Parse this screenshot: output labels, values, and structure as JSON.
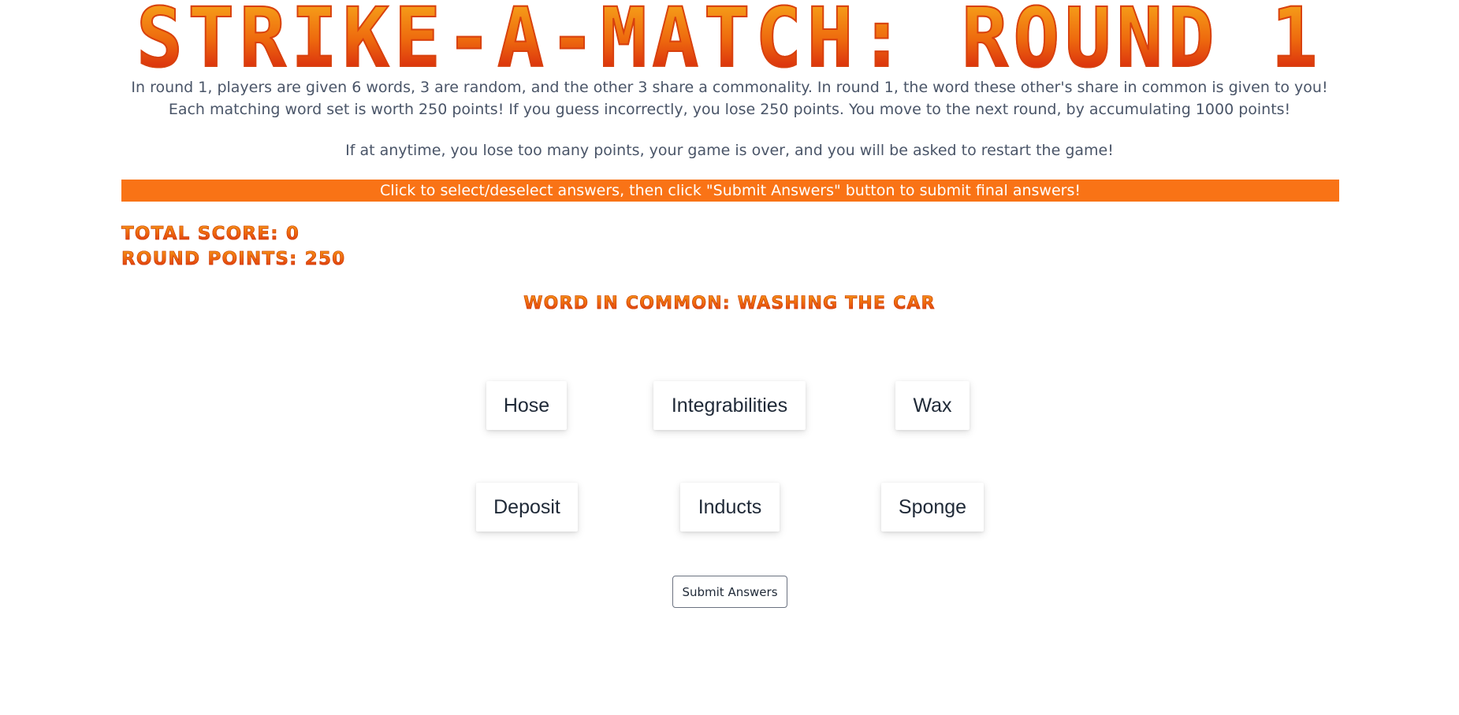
{
  "game": {
    "title": "Strike-a-Match: Round 1",
    "instructions": "In round 1, players are given 6 words, 3 are random, and the other 3 share a commonality. In round 1, the word these other's share in common is given to you! Each matching word set is worth 250 points! If you guess incorrectly, you lose 250 points. You move to the next round, by accumulating 1000 points!",
    "game_over_note": "If at anytime, you lose too many points, your game is over, and you will be asked to restart the game!",
    "banner": "Click to select/deselect answers, then click \"Submit Answers\" button to submit final answers!",
    "accent_color": "#f97316"
  },
  "scores": {
    "total_label": "Total Score: 0",
    "round_label": "Round Points: 250"
  },
  "common": {
    "label": "Word in Common: Washing the Car"
  },
  "words": [
    {
      "label": "Hose"
    },
    {
      "label": "Integrabilities"
    },
    {
      "label": "Wax"
    },
    {
      "label": "Deposit"
    },
    {
      "label": "Inducts"
    },
    {
      "label": "Sponge"
    }
  ],
  "actions": {
    "submit_label": "Submit Answers"
  }
}
